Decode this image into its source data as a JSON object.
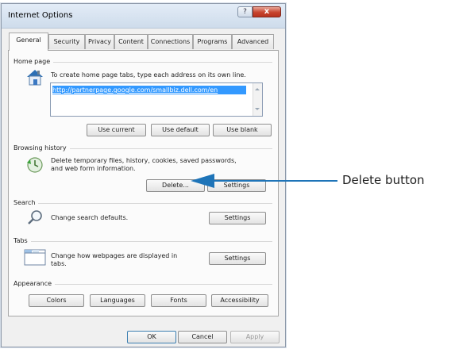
{
  "window": {
    "title": "Internet Options",
    "help_glyph": "?",
    "close_glyph": "x"
  },
  "tabs": [
    {
      "label": "General"
    },
    {
      "label": "Security"
    },
    {
      "label": "Privacy"
    },
    {
      "label": "Content"
    },
    {
      "label": "Connections"
    },
    {
      "label": "Programs"
    },
    {
      "label": "Advanced"
    }
  ],
  "home_page": {
    "header": "Home page",
    "description": "To create home page tabs, type each address on its own line.",
    "url": "http://partnerpage.google.com/smallbiz.dell.com/en",
    "buttons": {
      "use_current": "Use current",
      "use_default": "Use default",
      "use_blank": "Use blank"
    }
  },
  "browsing_history": {
    "header": "Browsing history",
    "description_line1": "Delete temporary files, history, cookies, saved passwords,",
    "description_line2": "and web form information.",
    "buttons": {
      "delete": "Delete...",
      "settings": "Settings"
    }
  },
  "search": {
    "header": "Search",
    "description": "Change search defaults.",
    "settings": "Settings"
  },
  "tabs_section": {
    "header": "Tabs",
    "description_line1": "Change how webpages are displayed in",
    "description_line2": "tabs.",
    "settings": "Settings"
  },
  "appearance": {
    "header": "Appearance",
    "buttons": {
      "colors": "Colors",
      "languages": "Languages",
      "fonts": "Fonts",
      "accessibility": "Accessibility"
    }
  },
  "footer": {
    "ok": "OK",
    "cancel": "Cancel",
    "apply": "Apply"
  },
  "annotation": {
    "label": "Delete button",
    "color": "#1e74b8"
  }
}
